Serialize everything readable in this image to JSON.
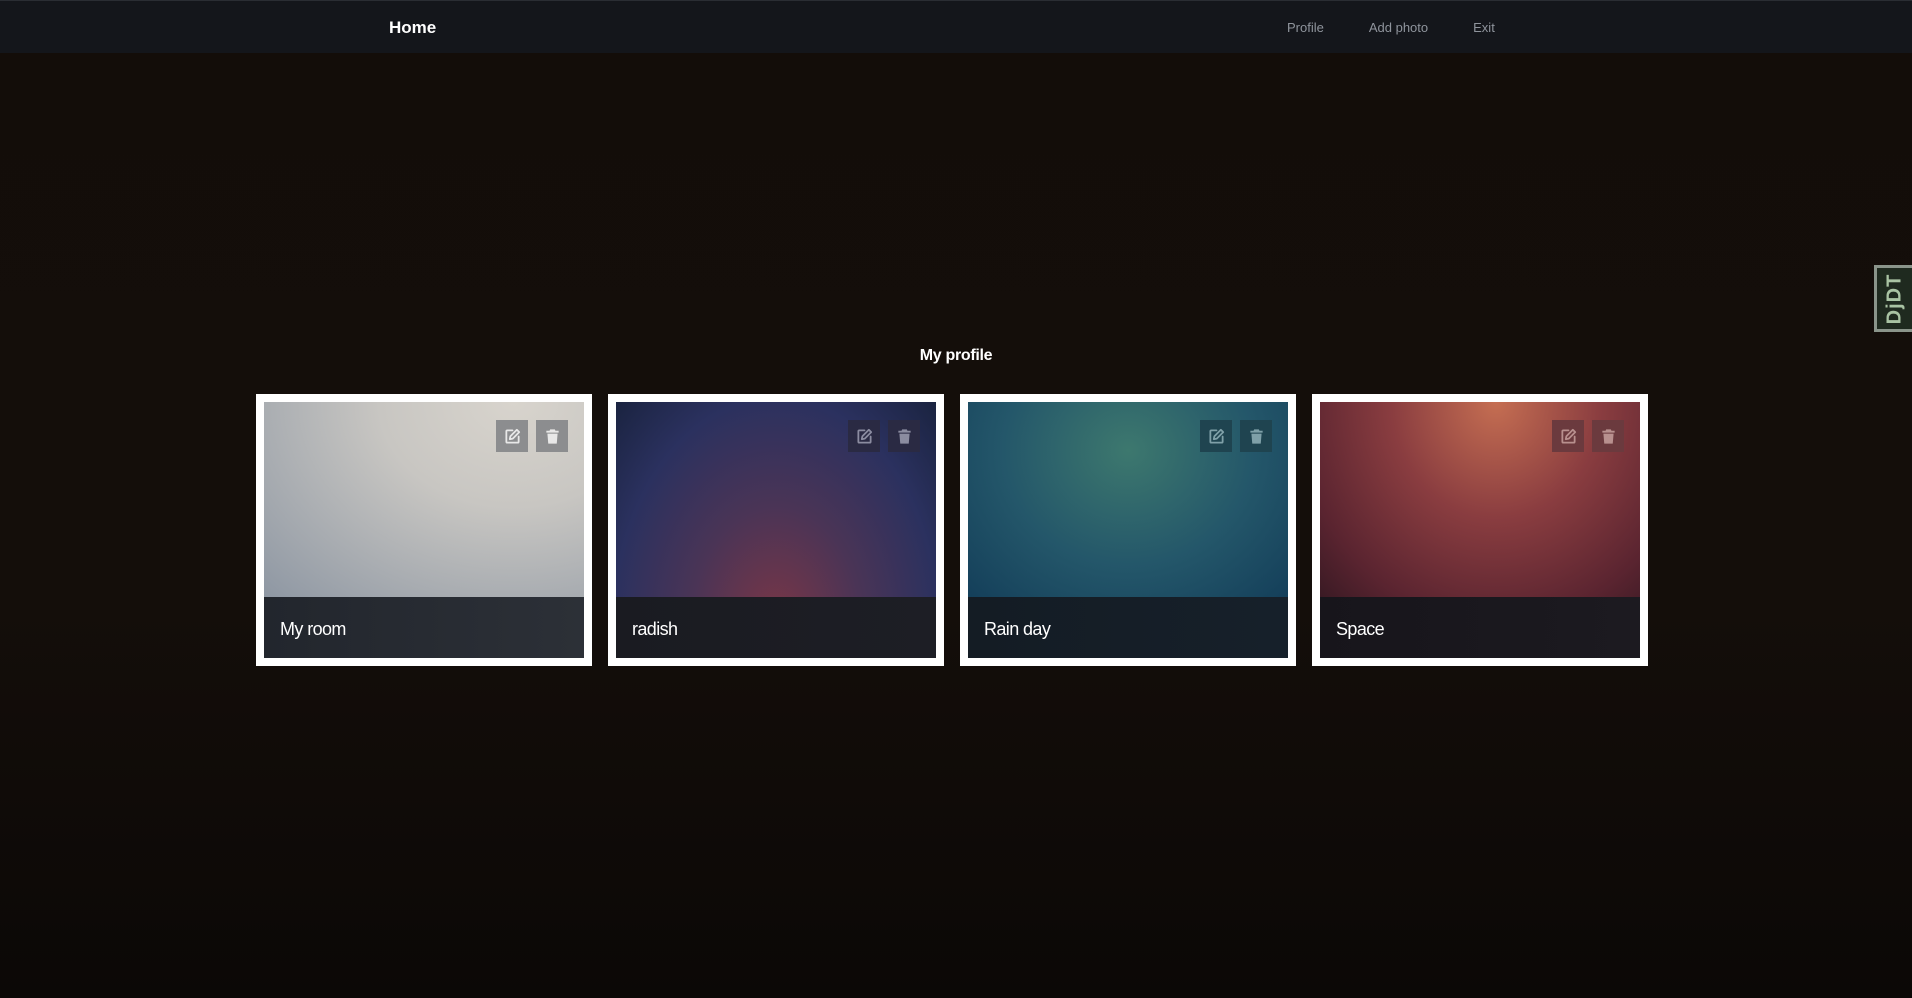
{
  "navbar": {
    "brand": "Home",
    "links": [
      {
        "label": "Profile"
      },
      {
        "label": "Add photo"
      },
      {
        "label": "Exit"
      }
    ]
  },
  "debug_toolbar": {
    "label": "DjDT"
  },
  "main": {
    "title": "My profile",
    "photos": [
      {
        "caption": "My room",
        "edit_icon": "edit-icon",
        "delete_icon": "trash-icon"
      },
      {
        "caption": "radish",
        "edit_icon": "edit-icon",
        "delete_icon": "trash-icon"
      },
      {
        "caption": "Rain day",
        "edit_icon": "edit-icon",
        "delete_icon": "trash-icon"
      },
      {
        "caption": "Space",
        "edit_icon": "edit-icon",
        "delete_icon": "trash-icon"
      }
    ]
  },
  "colors": {
    "background": "#130d09",
    "navbar": "#14161b",
    "card_border": "#ffffff"
  }
}
